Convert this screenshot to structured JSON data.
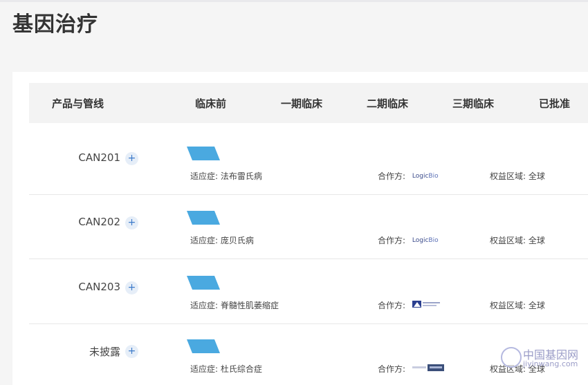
{
  "page_title": "基因治疗",
  "table": {
    "headers": [
      "产品与管线",
      "临床前",
      "一期临床",
      "二期临床",
      "三期临床",
      "已批准"
    ]
  },
  "rows": [
    {
      "product": "CAN201",
      "expand_label": "+",
      "indication": "适应症: 法布雷氏病",
      "partner_label": "合作方:",
      "partner_logo": "LogicBio",
      "rights": "权益区域: 全球",
      "stage": "临床前"
    },
    {
      "product": "CAN202",
      "expand_label": "+",
      "indication": "适应症: 庞贝氏病",
      "partner_label": "合作方:",
      "partner_logo": "LogicBio",
      "rights": "权益区域: 全球",
      "stage": "临床前"
    },
    {
      "product": "CAN203",
      "expand_label": "+",
      "indication": "适应症: 脊髓性肌萎缩症",
      "partner_label": "合作方:",
      "partner_logo": "",
      "rights": "权益区域: 全球",
      "stage": "临床前"
    },
    {
      "product": "未披露",
      "expand_label": "+",
      "indication": "适应症: 杜氏综合症",
      "partner_label": "合作方:",
      "partner_logo": "",
      "rights": "权益区域: 全球",
      "stage": "临床前"
    }
  ],
  "watermark": {
    "text": "中国基因网",
    "url": "jiyinwang.com"
  },
  "colors": {
    "bar": "#4aa9e0",
    "plus_bg": "#e6eef8",
    "plus_fg": "#3b79c9",
    "header_bg": "#f3f3f3"
  }
}
